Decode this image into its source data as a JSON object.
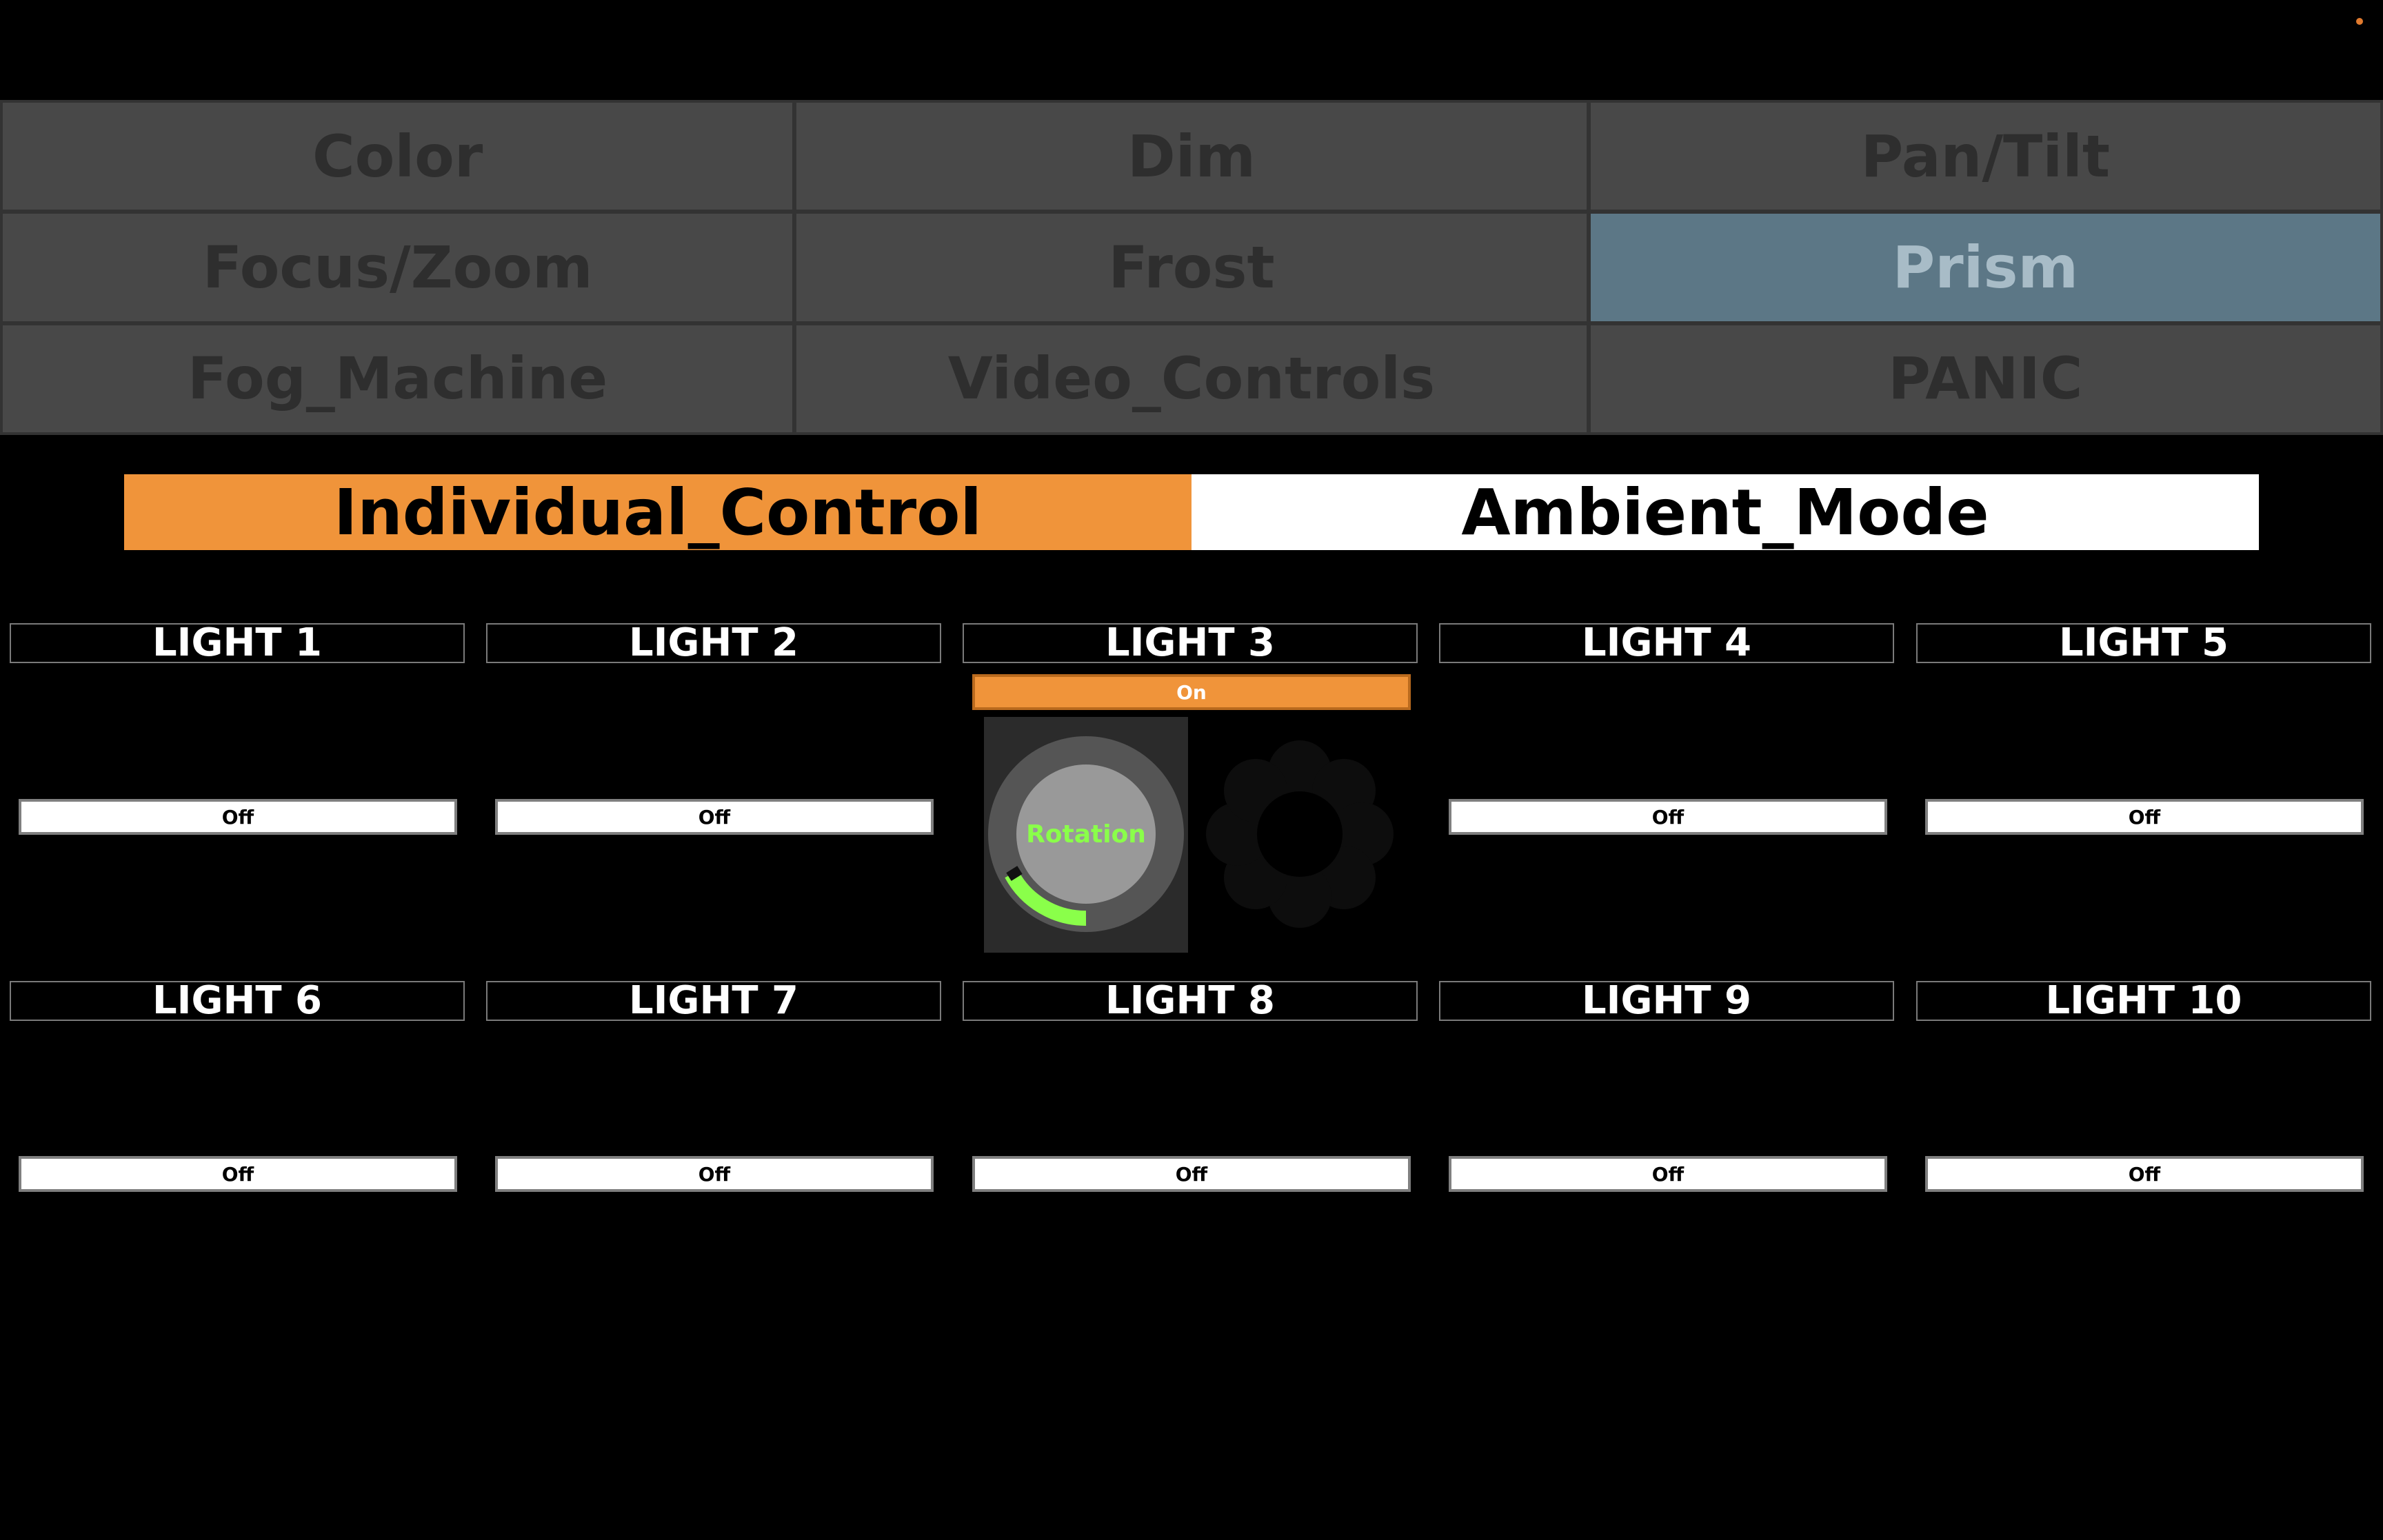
{
  "colors": {
    "accent_orange": "#f0943a",
    "prism_active": "#5c7786",
    "rotation_green": "#8aff4a",
    "status_dot": "#e07a2e"
  },
  "menu": {
    "items": [
      {
        "label": "Color"
      },
      {
        "label": "Dim"
      },
      {
        "label": "Pan/Tilt"
      },
      {
        "label": "Focus/Zoom"
      },
      {
        "label": "Frost"
      },
      {
        "label": "Prism",
        "active": true
      },
      {
        "label": "Fog_Machine"
      },
      {
        "label": "Video_Controls"
      },
      {
        "label": "PANIC"
      }
    ]
  },
  "modes": {
    "individual": {
      "label": "Individual_Control",
      "active": true
    },
    "ambient": {
      "label": "Ambient_Mode"
    }
  },
  "lights": [
    {
      "name": "LIGHT 1",
      "state": "Off"
    },
    {
      "name": "LIGHT 2",
      "state": "Off"
    },
    {
      "name": "LIGHT 3",
      "state": "On"
    },
    {
      "name": "LIGHT 4",
      "state": "Off"
    },
    {
      "name": "LIGHT 5",
      "state": "Off"
    },
    {
      "name": "LIGHT 6",
      "state": "Off"
    },
    {
      "name": "LIGHT 7",
      "state": "Off"
    },
    {
      "name": "LIGHT 8",
      "state": "Off"
    },
    {
      "name": "LIGHT 9",
      "state": "Off"
    },
    {
      "name": "LIGHT 10",
      "state": "Off"
    }
  ],
  "rotation": {
    "label": "Rotation",
    "value": 0.25
  }
}
